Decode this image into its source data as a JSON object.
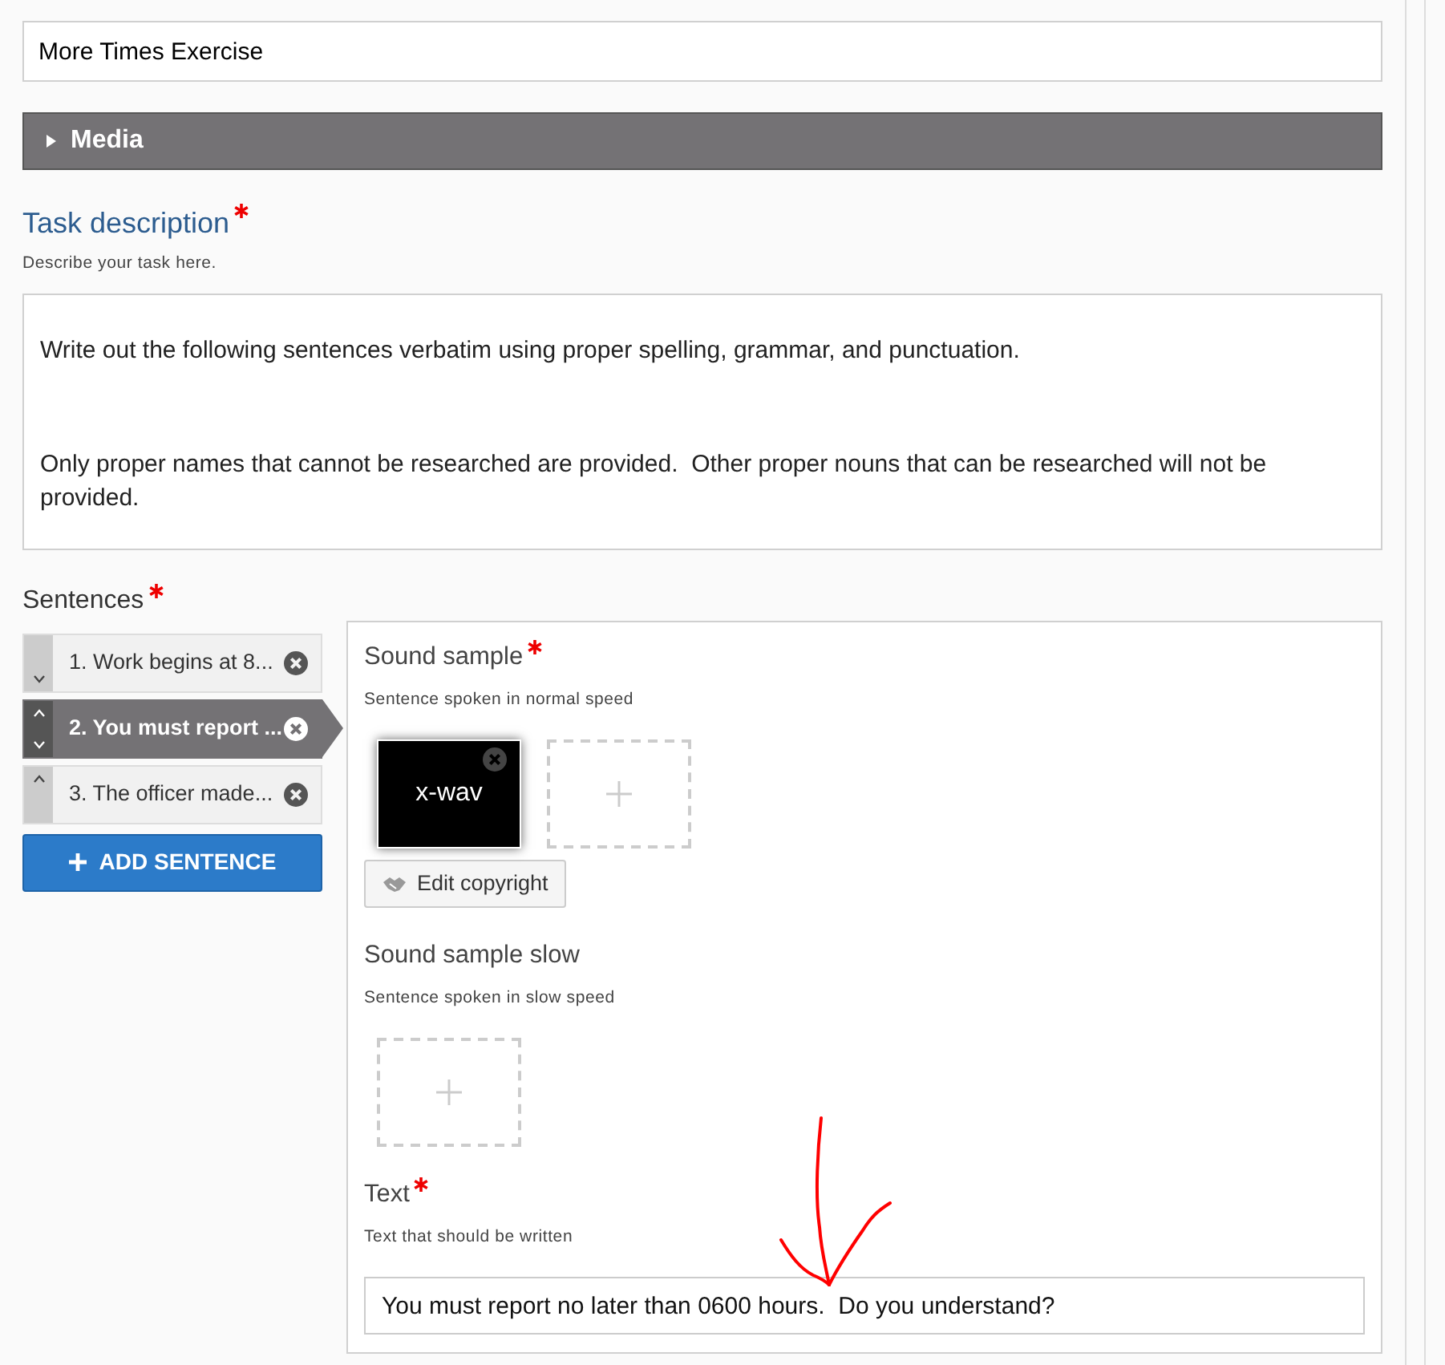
{
  "title_field": {
    "value": "More Times Exercise"
  },
  "media_panel": {
    "label": "Media",
    "expanded": false
  },
  "task_description": {
    "label": "Task description",
    "required": true,
    "help": "Describe your task here.",
    "paragraphs": [
      "Write out the following sentences verbatim using proper spelling, grammar, and punctuation.",
      "Only proper names that cannot be researched are provided.  Other proper nouns that can be researched will not be provided."
    ]
  },
  "sentences": {
    "label": "Sentences",
    "required": true,
    "items": [
      {
        "label": "1. Work begins at 8...",
        "selected": false,
        "move_up": false,
        "move_down": true
      },
      {
        "label": "2. You must report ...",
        "selected": true,
        "move_up": true,
        "move_down": true
      },
      {
        "label": "3. The officer made...",
        "selected": false,
        "move_up": true,
        "move_down": false
      }
    ],
    "add_button": "ADD SENTENCE"
  },
  "editor": {
    "fields": [
      {
        "kind": "audio",
        "label": "Sound sample",
        "required": true,
        "help": "Sentence spoken in normal speed",
        "files": [
          {
            "label": "x-wav"
          }
        ],
        "copyright_button": "Edit copyright"
      },
      {
        "kind": "audio",
        "label": "Sound sample slow",
        "required": false,
        "help": "Sentence spoken in slow speed"
      },
      {
        "kind": "text",
        "label": "Text",
        "required": true,
        "help": "Text that should be written",
        "value": "You must report no later than 0600 hours.  Do you understand?"
      }
    ]
  }
}
